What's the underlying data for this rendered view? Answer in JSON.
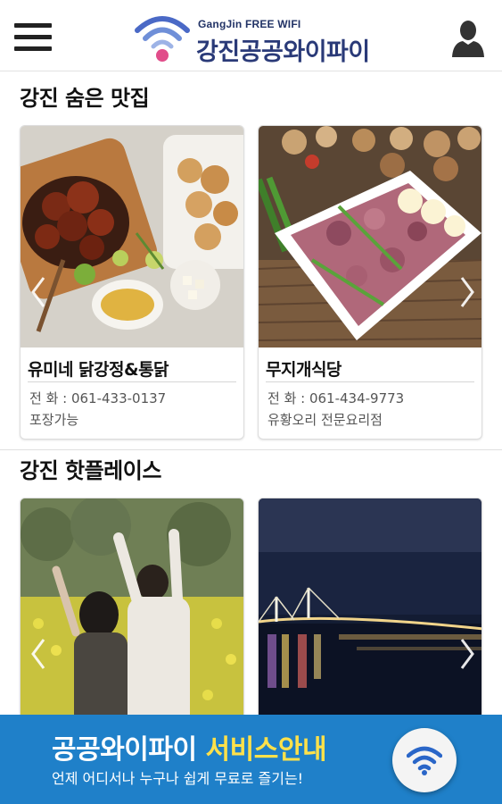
{
  "header": {
    "menu_icon": "hamburger-menu-icon",
    "logo_subtitle": "GangJin FREE WIFI",
    "logo_title": "강진공공와이파이",
    "user_icon": "user-silhouette-icon"
  },
  "sections": [
    {
      "title": "강진 숨은 맛집",
      "cards": [
        {
          "name": "유미네 닭강정&통닭",
          "phone": "전 화 : 061-433-0137",
          "desc": "포장가능",
          "image": "fried-chicken-photo"
        },
        {
          "name": "무지개식당",
          "phone": "전 화 : 061-434-9773",
          "desc": "유황오리 전문요리점",
          "image": "duck-meat-platter-photo"
        }
      ]
    },
    {
      "title": "강진 핫플레이스",
      "cards": [
        {
          "image": "couple-in-canola-field-photo"
        },
        {
          "image": "bridge-night-view-photo"
        }
      ]
    }
  ],
  "banner": {
    "title_main": "공공와이파이 ",
    "title_accent": "서비스안내",
    "subtitle": "언제 어디서나 누구나 쉽게 무료로 즐기는!",
    "icon": "wifi-icon"
  },
  "colors": {
    "brand_blue": "#1f80c9",
    "accent_yellow": "#ffe14a",
    "logo_navy": "#2a3a78"
  }
}
